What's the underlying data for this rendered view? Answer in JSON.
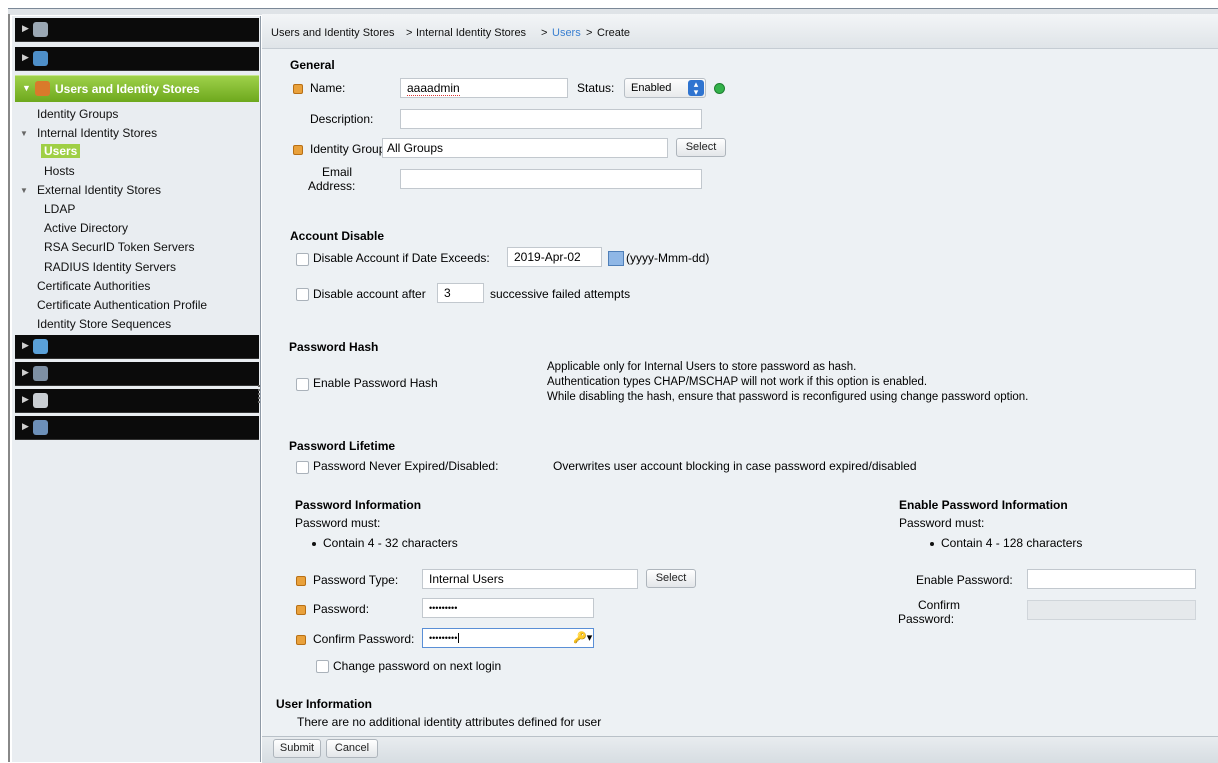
{
  "breadcrumb": {
    "part1": "Users and Identity Stores",
    "sep1": ">",
    "part2": "Internal Identity Stores",
    "sep2": ">",
    "part3": "Users",
    "sep3": ">",
    "part4": "Create"
  },
  "sidebar": {
    "active_section": "Users and Identity Stores",
    "items": [
      {
        "label": "Identity Groups"
      },
      {
        "label": "Internal Identity Stores"
      },
      {
        "label": "Users"
      },
      {
        "label": "Hosts"
      },
      {
        "label": "External Identity Stores"
      },
      {
        "label": "LDAP"
      },
      {
        "label": "Active Directory"
      },
      {
        "label": "RSA SecurID Token Servers"
      },
      {
        "label": "RADIUS Identity Servers"
      },
      {
        "label": "Certificate Authorities"
      },
      {
        "label": "Certificate Authentication Profile"
      },
      {
        "label": "Identity Store Sequences"
      }
    ],
    "icons": [
      "network-resources-icon",
      "users-identity-icon",
      "access-policies-icon",
      "monitoring-icon",
      "reports-icon",
      "system-admin-icon"
    ]
  },
  "general": {
    "title": "General",
    "name_label": "Name:",
    "name_value": "aaaadmin",
    "status_label": "Status:",
    "status_value": "Enabled",
    "description_label": "Description:",
    "description_value": "",
    "identity_group_label": "Identity Group:",
    "identity_group_value": "All Groups",
    "select_label": "Select",
    "email_label_1": "Email",
    "email_label_2": "Address:",
    "email_value": ""
  },
  "account_disable": {
    "title": "Account Disable",
    "date_label": "Disable Account if Date Exceeds:",
    "date_value": "2019-Apr-02",
    "date_format": "(yyyy-Mmm-dd)",
    "after_label": "Disable account after",
    "after_value": "3",
    "after_suffix": "successive failed attempts"
  },
  "password_hash": {
    "title": "Password Hash",
    "enable_label": "Enable Password Hash",
    "note1": "Applicable only for Internal Users to store password as hash.",
    "note2": "Authentication types CHAP/MSCHAP will not work if this option is enabled.",
    "note3": "While disabling the hash, ensure that password is reconfigured using change password option."
  },
  "password_lifetime": {
    "title": "Password Lifetime",
    "never_expired_label": "Password Never Expired/Disabled:",
    "note": "Overwrites user account blocking in case password expired/disabled"
  },
  "password_info": {
    "title": "Password Information",
    "must": "Password must:",
    "rule": "Contain 4 - 32 characters",
    "type_label": "Password Type:",
    "type_value": "Internal Users",
    "select_label": "Select",
    "password_label": "Password:",
    "password_value": "•••••••••",
    "confirm_label": "Confirm Password:",
    "confirm_value": "•••••••••",
    "change_label": "Change password on next login"
  },
  "enable_password_info": {
    "title": "Enable Password Information",
    "must": "Password must:",
    "rule": "Contain 4 - 128 characters",
    "enable_label": "Enable Password:",
    "enable_value": "",
    "confirm_label_1": "Confirm",
    "confirm_label_2": "Password:",
    "confirm_value": ""
  },
  "user_info": {
    "title": "User Information",
    "note": "There are no additional identity attributes defined for user"
  },
  "footer": {
    "submit": "Submit",
    "cancel": "Cancel"
  },
  "colors": {
    "active_nav": "#8cc63f",
    "link": "#3a7fd0",
    "required_marker": "#e9a13b",
    "status_enabled": "#33b24a"
  }
}
